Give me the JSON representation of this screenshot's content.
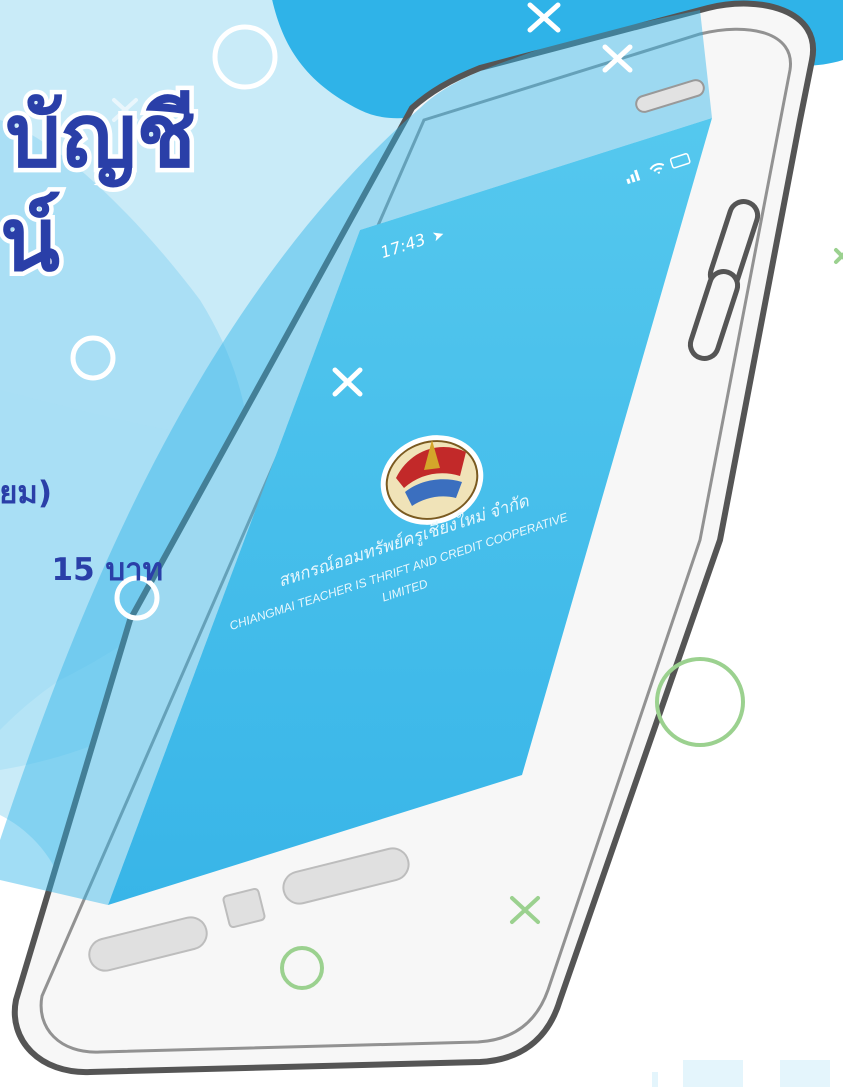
{
  "promo": {
    "headline_line1": "บัญชี",
    "headline_line2": "น์",
    "detail_line1": "ยม)",
    "detail_line2": "15 บาท"
  },
  "phone": {
    "status_time": "17:43",
    "status_icons": [
      "signal-icon",
      "wifi-icon",
      "battery-icon"
    ],
    "coop_name_th": "สหกรณ์ออมทรัพย์ครูเชียงใหม่ จำกัด",
    "coop_name_en_line1": "CHIANGMAI TEACHER IS THRIFT AND CREDIT COOPERATIVE",
    "coop_name_en_line2": "LIMITED"
  },
  "decorations": {
    "icons": [
      "circle-outline-icon",
      "cross-mark-icon"
    ]
  },
  "colors": {
    "headline": "#2a3fa8",
    "screen": "#4bc2ea",
    "blob": "#2fb3e8",
    "accent_green": "#9bd18f",
    "phone_body": "#f7f7f7",
    "phone_outline": "#555555"
  }
}
